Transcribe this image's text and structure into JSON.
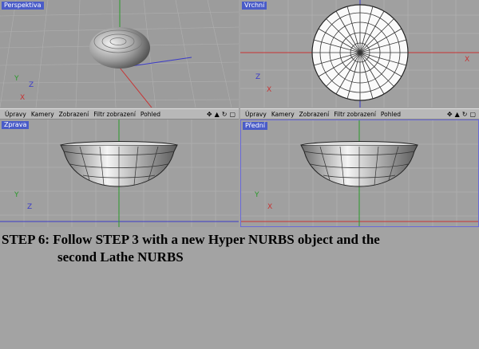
{
  "viewports": {
    "perspective": {
      "label": "Perspektiva"
    },
    "top": {
      "label": "Vrchní"
    },
    "right": {
      "label": "Zprava"
    },
    "front": {
      "label": "Přední"
    }
  },
  "menu": {
    "items": [
      "Úpravy",
      "Kamery",
      "Zobrazení",
      "Filtr zobrazení",
      "Pohled"
    ],
    "tool_icons": [
      "move-view-icon",
      "zoom-view-icon",
      "rotate-view-icon",
      "maximize-view-icon"
    ]
  },
  "axes": {
    "x": "X",
    "y": "Y",
    "z": "Z"
  },
  "caption": {
    "line1": "STEP 6: Follow STEP 3 with a new Hyper NURBS object and the",
    "line2": "second Lathe NURBS"
  },
  "colors": {
    "label_bg": "#4a5cc8",
    "axis_red": "#c83232",
    "axis_green": "#2a9a2a",
    "axis_blue": "#3a3ac8"
  }
}
